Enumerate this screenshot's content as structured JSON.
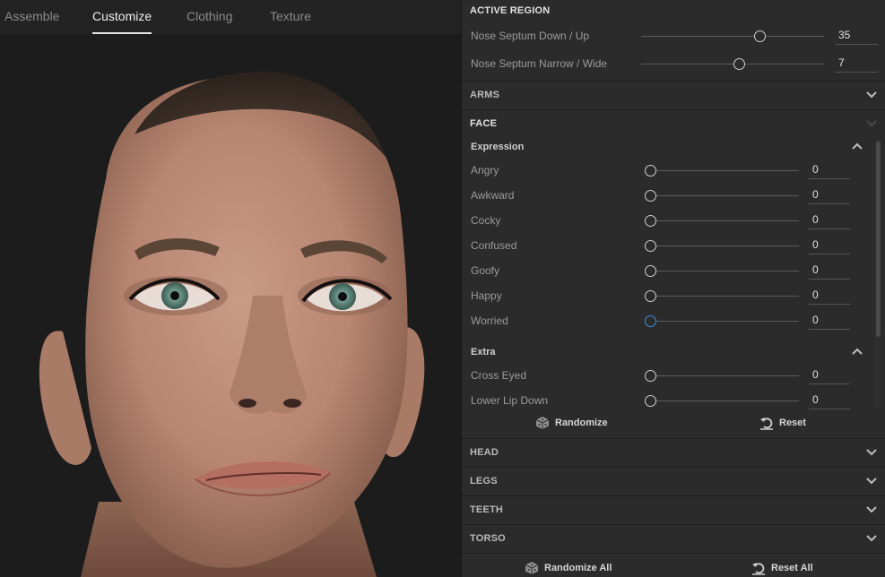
{
  "tabs": [
    {
      "label": "Assemble",
      "active": false
    },
    {
      "label": "Customize",
      "active": true
    },
    {
      "label": "Clothing",
      "active": false
    },
    {
      "label": "Texture",
      "active": false
    }
  ],
  "active_region": {
    "title": "ACTIVE REGION",
    "sliders": [
      {
        "label": "Nose Septum Down / Up",
        "value": "35"
      },
      {
        "label": "Nose Septum Narrow / Wide",
        "value": "7"
      }
    ]
  },
  "sections": {
    "arms": "ARMS",
    "face": "FACE",
    "head": "HEAD",
    "legs": "LEGS",
    "teeth": "TEETH",
    "torso": "TORSO"
  },
  "face": {
    "expression_title": "Expression",
    "expression": [
      {
        "label": "Angry",
        "value": "0"
      },
      {
        "label": "Awkward",
        "value": "0"
      },
      {
        "label": "Cocky",
        "value": "0"
      },
      {
        "label": "Confused",
        "value": "0"
      },
      {
        "label": "Goofy",
        "value": "0"
      },
      {
        "label": "Happy",
        "value": "0"
      },
      {
        "label": "Worried",
        "value": "0"
      }
    ],
    "extra_title": "Extra",
    "extra": [
      {
        "label": "Cross Eyed",
        "value": "0"
      },
      {
        "label": "Lower Lip Down",
        "value": "0"
      }
    ],
    "randomize": "Randomize",
    "reset": "Reset"
  },
  "footer": {
    "randomize_all": "Randomize All",
    "reset_all": "Reset All"
  },
  "icons": {
    "section_toggle": "chevron-down-icon",
    "group_toggle": "chevron-up-icon",
    "randomize": "dice-icon",
    "reset": "undo-icon"
  },
  "colors": {
    "panel_bg": "#2b2b2b",
    "viewport_bg": "#1c1c1c",
    "focus_accent": "#3d8fe0"
  }
}
